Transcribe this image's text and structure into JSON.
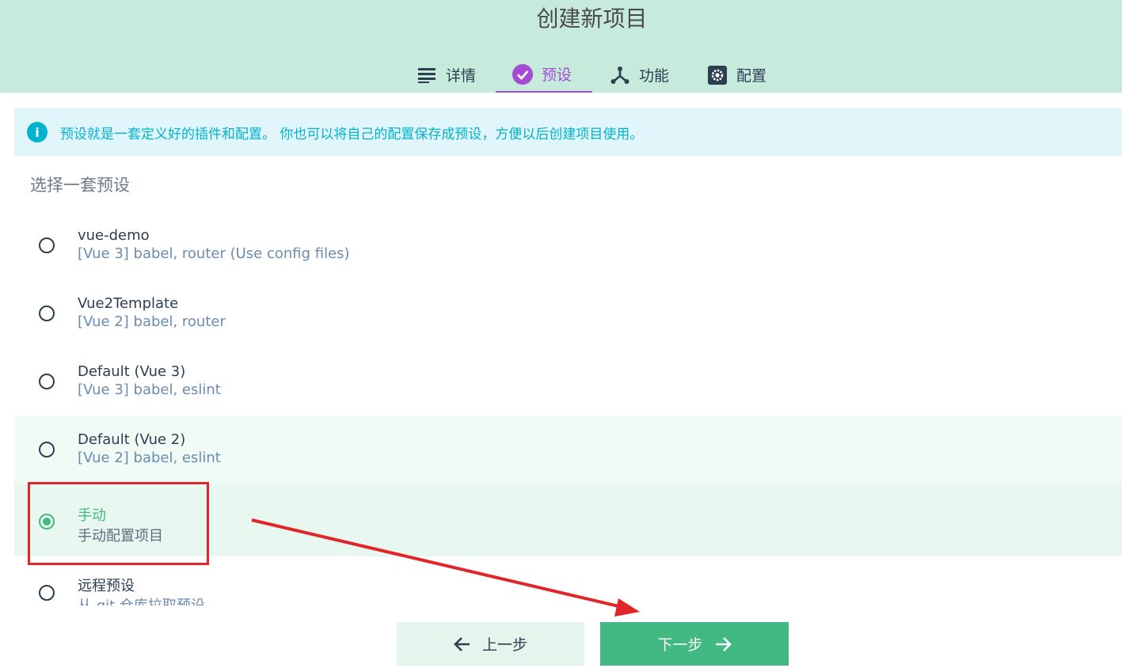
{
  "header": {
    "title": "创建新项目",
    "tabs": [
      {
        "label": "详情",
        "icon": "list-icon",
        "active": false
      },
      {
        "label": "预设",
        "icon": "check-circle-icon",
        "active": true
      },
      {
        "label": "功能",
        "icon": "fork-icon",
        "active": false
      },
      {
        "label": "配置",
        "icon": "settings-icon",
        "active": false
      }
    ],
    "accent_color": "#a44cd3",
    "background_color": "#c6ebdd"
  },
  "info": {
    "icon": "info-icon",
    "icon_text": "i",
    "text": "预设就是一套定义好的插件和配置。 你也可以将自己的配置保存成预设，方便以后创建项目使用。",
    "color": "#03b2ce"
  },
  "section_title": "选择一套预设",
  "presets": [
    {
      "name": "vue-demo",
      "desc": "[Vue 3] babel, router (Use config files)",
      "selected": false
    },
    {
      "name": "Vue2Template",
      "desc": "[Vue 2] babel, router",
      "selected": false
    },
    {
      "name": "Default (Vue 3)",
      "desc": "[Vue 3] babel, eslint",
      "selected": false
    },
    {
      "name": "Default (Vue 2)",
      "desc": "[Vue 2] babel, eslint",
      "selected": false
    },
    {
      "name": "手动",
      "desc": "手动配置项目",
      "selected": true
    },
    {
      "name": "远程预设",
      "desc": "从 git 仓库拉取预设",
      "selected": false
    }
  ],
  "buttons": {
    "prev_label": "上一步",
    "next_label": "下一步"
  },
  "colors": {
    "primary": "#42b983",
    "annotation": "#e0262b"
  }
}
